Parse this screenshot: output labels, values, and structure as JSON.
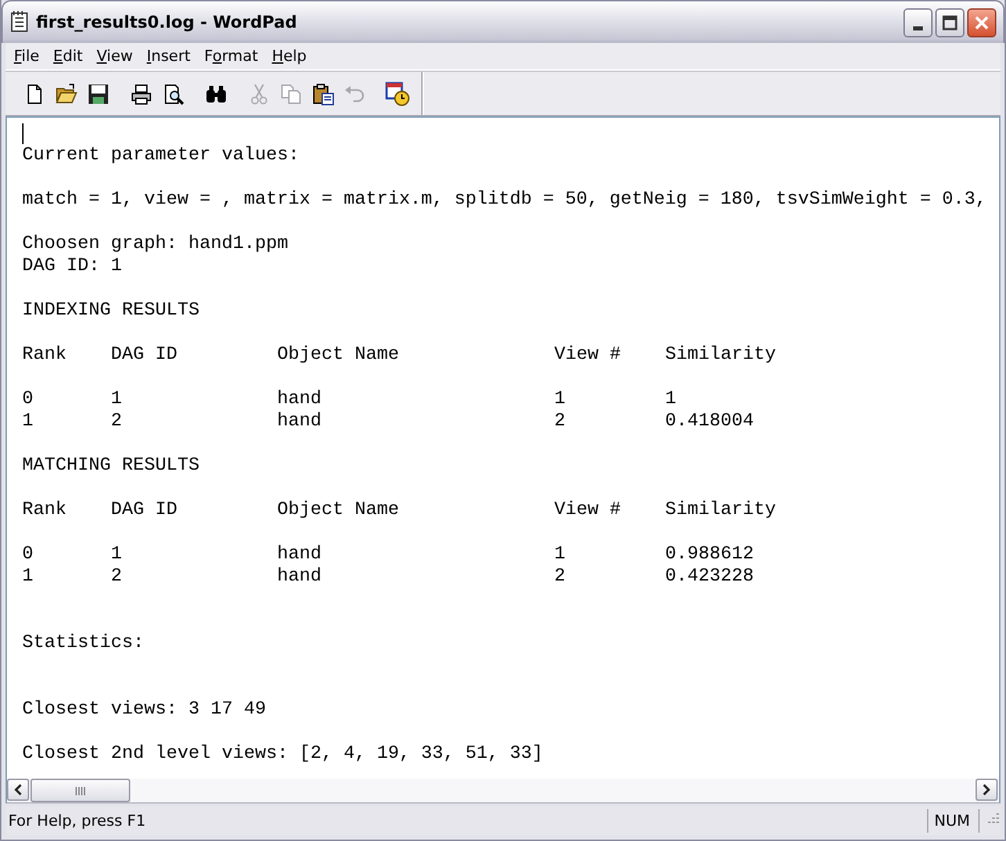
{
  "window": {
    "title": "first_results0.log - WordPad",
    "controls": [
      {
        "kind": "minimize"
      },
      {
        "kind": "maximize"
      },
      {
        "kind": "close"
      }
    ]
  },
  "menu": [
    {
      "label": "File",
      "kind": "first_letter"
    },
    {
      "label": "Edit",
      "kind": "first_letter"
    },
    {
      "label": "View",
      "kind": "first_letter"
    },
    {
      "label": "Insert",
      "kind": "first_letter"
    },
    {
      "label": "Format",
      "kind": "second_letter"
    },
    {
      "label": "Help",
      "kind": "first_letter"
    }
  ],
  "toolbar": {
    "groups": [
      [
        {
          "kind": "new",
          "disabled": false
        },
        {
          "kind": "open",
          "disabled": false
        },
        {
          "kind": "save",
          "disabled": false
        }
      ],
      [
        {
          "kind": "print",
          "disabled": false
        },
        {
          "kind": "preview",
          "disabled": false
        }
      ],
      [
        {
          "kind": "find",
          "disabled": false
        }
      ],
      [
        {
          "kind": "cut",
          "disabled": true
        },
        {
          "kind": "copy",
          "disabled": true
        },
        {
          "kind": "paste",
          "disabled": false
        },
        {
          "kind": "undo",
          "disabled": true
        }
      ],
      [
        {
          "kind": "datetime",
          "disabled": false
        }
      ]
    ]
  },
  "document": {
    "blocks": [
      {
        "kind": "caret"
      },
      {
        "kind": "text",
        "lines": [
          "Current parameter values:"
        ]
      },
      {
        "kind": "blank"
      },
      {
        "kind": "text",
        "lines": [
          "match = 1, view = , matrix = matrix.m, splitdb = 50, getNeig = 180, tsvSimWeight = 0.3,"
        ]
      },
      {
        "kind": "blank"
      },
      {
        "kind": "text",
        "lines": [
          "Choosen graph: hand1.ppm",
          "DAG ID: 1"
        ]
      },
      {
        "kind": "blank"
      },
      {
        "kind": "text",
        "lines": [
          "INDEXING RESULTS"
        ]
      },
      {
        "kind": "blank"
      },
      {
        "kind": "table",
        "columns": [
          "Rank",
          "DAG ID",
          "Object Name",
          "View #",
          "Similarity"
        ],
        "rows": [
          [
            "0",
            "1",
            "hand",
            "1",
            "1"
          ],
          [
            "1",
            "2",
            "hand",
            "2",
            "0.418004"
          ]
        ]
      },
      {
        "kind": "blank"
      },
      {
        "kind": "text",
        "lines": [
          "MATCHING RESULTS"
        ]
      },
      {
        "kind": "blank"
      },
      {
        "kind": "table",
        "columns": [
          "Rank",
          "DAG ID",
          "Object Name",
          "View #",
          "Similarity"
        ],
        "rows": [
          [
            "0",
            "1",
            "hand",
            "1",
            "0.988612"
          ],
          [
            "1",
            "2",
            "hand",
            "2",
            "0.423228"
          ]
        ]
      },
      {
        "kind": "blank"
      },
      {
        "kind": "blank"
      },
      {
        "kind": "text",
        "lines": [
          "Statistics:"
        ]
      },
      {
        "kind": "blank"
      },
      {
        "kind": "blank"
      },
      {
        "kind": "text",
        "lines": [
          "Closest views: 3 17 49"
        ]
      },
      {
        "kind": "blank"
      },
      {
        "kind": "text",
        "lines": [
          "Closest 2nd level views: [2, 4, 19, 33, 51, 33]"
        ]
      }
    ]
  },
  "status_bar": {
    "message": "For Help, press F1",
    "indicators": [
      "NUM"
    ]
  }
}
